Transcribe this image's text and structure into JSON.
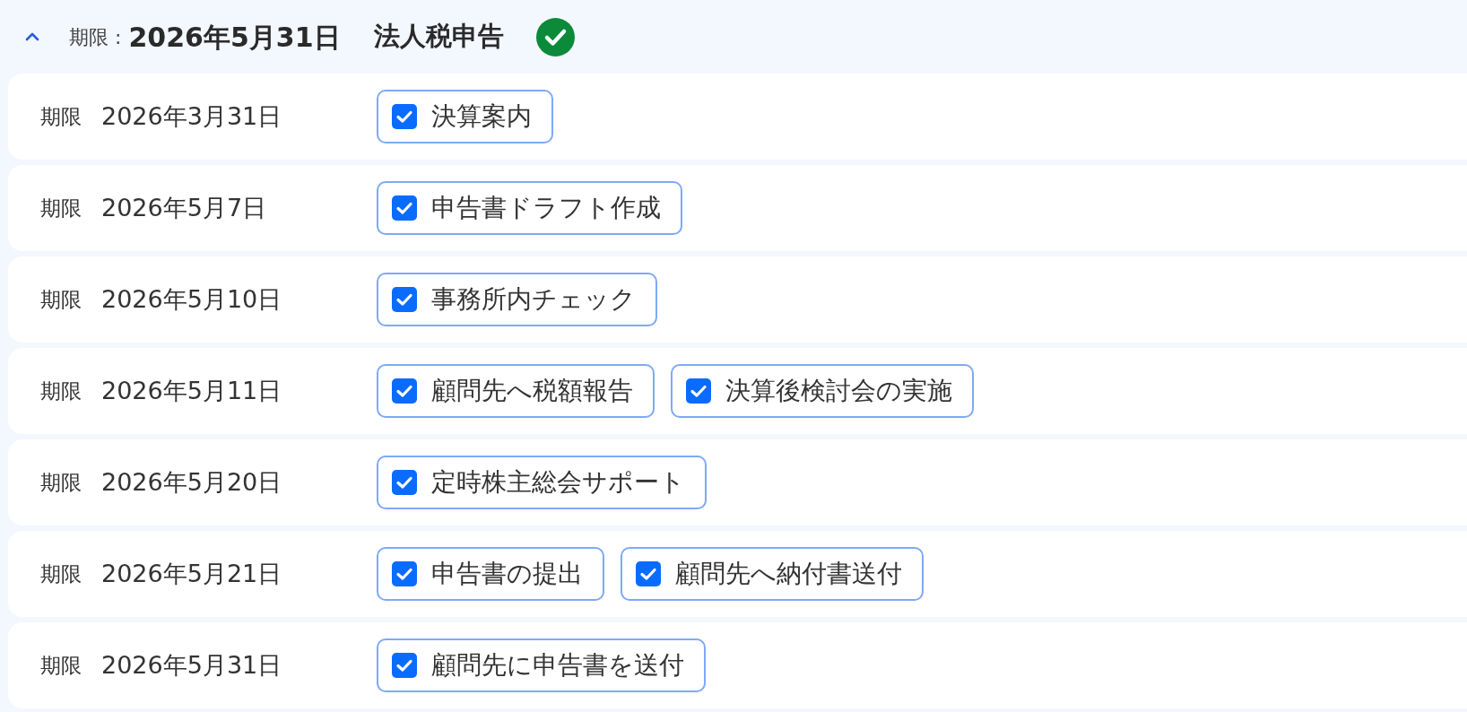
{
  "header": {
    "expanded": true,
    "deadline_label": "期限 :",
    "deadline": "2026年5月31日",
    "title": "法人税申告",
    "completed": true
  },
  "rows": [
    {
      "label": "期限",
      "date": "2026年3月31日",
      "tasks": [
        {
          "name": "決算案内",
          "checked": true
        }
      ]
    },
    {
      "label": "期限",
      "date": "2026年5月7日",
      "tasks": [
        {
          "name": "申告書ドラフト作成",
          "checked": true
        }
      ]
    },
    {
      "label": "期限",
      "date": "2026年5月10日",
      "tasks": [
        {
          "name": "事務所内チェック",
          "checked": true
        }
      ]
    },
    {
      "label": "期限",
      "date": "2026年5月11日",
      "tasks": [
        {
          "name": "顧問先へ税額報告",
          "checked": true
        },
        {
          "name": "決算後検討会の実施",
          "checked": true
        }
      ]
    },
    {
      "label": "期限",
      "date": "2026年5月20日",
      "tasks": [
        {
          "name": "定時株主総会サポート",
          "checked": true
        }
      ]
    },
    {
      "label": "期限",
      "date": "2026年5月21日",
      "tasks": [
        {
          "name": "申告書の提出",
          "checked": true
        },
        {
          "name": "顧問先へ納付書送付",
          "checked": true
        }
      ]
    },
    {
      "label": "期限",
      "date": "2026年5月31日",
      "tasks": [
        {
          "name": "顧問先に申告書を送付",
          "checked": true
        }
      ]
    }
  ]
}
